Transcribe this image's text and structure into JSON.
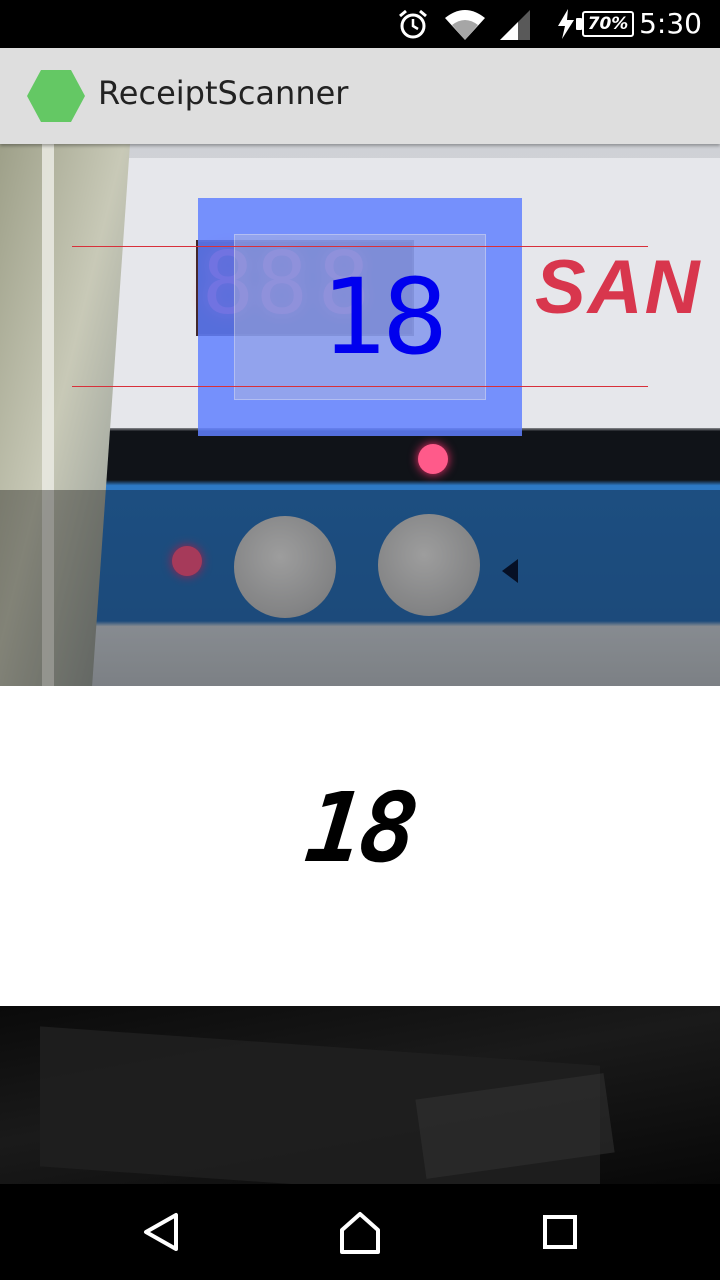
{
  "status_bar": {
    "time": "5:30",
    "battery_percent": "70%",
    "icons": [
      "alarm-icon",
      "wifi-icon",
      "signal-icon",
      "charging-icon",
      "battery-icon"
    ]
  },
  "app_bar": {
    "title": "ReceiptScanner",
    "logo_icon": "hexagon-logo-icon",
    "logo_color": "#64c864"
  },
  "camera": {
    "ocr_result": "18",
    "ocr_color": "#0000ee",
    "roi_color": "#6080ff",
    "guide_line_color": "#d8303a"
  },
  "binarized_preview": {
    "text": "18"
  },
  "nav_bar": {
    "buttons": [
      "back-icon",
      "home-icon",
      "recents-icon"
    ]
  }
}
